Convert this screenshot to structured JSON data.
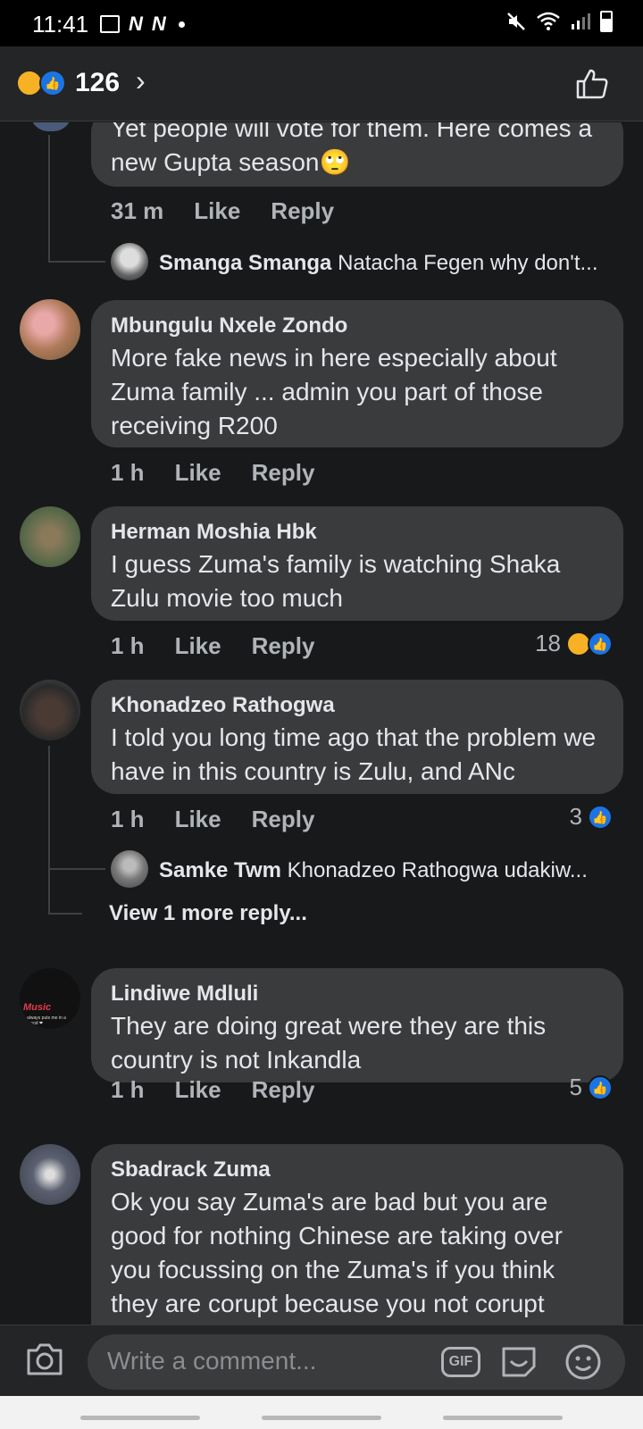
{
  "status_bar": {
    "time": "11:41",
    "n1": "N",
    "n2": "N"
  },
  "header": {
    "reaction_count": "126",
    "chevron": "›"
  },
  "comments_top": {
    "partial_text": "Yet people will vote for them. Here comes a new Gupta season🙄",
    "time": "31 m",
    "like": "Like",
    "reply": "Reply",
    "reply_preview_author": "Smanga Smanga",
    "reply_preview_text": "Natacha Fegen why don't..."
  },
  "comments": [
    {
      "author": "Mbungulu Nxele Zondo",
      "text": "More fake news in here especially about Zuma family ... admin you part of those receiving R200",
      "time": "1 h",
      "like": "Like",
      "reply": "Reply",
      "reactions": ""
    },
    {
      "author": "Herman Moshia Hbk",
      "text": "I guess Zuma's family is watching Shaka Zulu movie too much",
      "time": "1 h",
      "like": "Like",
      "reply": "Reply",
      "reactions": "18"
    },
    {
      "author": "Khonadzeo Rathogwa",
      "text": "I told you long time ago that the problem we have in this country is Zulu, and ANc",
      "time": "1 h",
      "like": "Like",
      "reply": "Reply",
      "reactions": "3",
      "reply_preview_author": "Samke Twm",
      "reply_preview_text": "Khonadzeo Rathogwa udakiw...",
      "view_more": "View 1 more reply..."
    },
    {
      "author": "Lindiwe Mdluli",
      "avatar_text": "Music",
      "avatar_subtext": "always puts me in a mood ❤",
      "text": "They are doing great were they are this country is not Inkandla",
      "time": "1 h",
      "like": "Like",
      "reply": "Reply",
      "reactions": "5"
    },
    {
      "author": "Sbadrack Zuma",
      "text": "Ok you say Zuma's are bad but you are good for nothing Chinese are taking over you focussing on the Zuma's if you think they are corupt  because you not corupt"
    }
  ],
  "composer": {
    "placeholder": "Write a comment...",
    "gif_label": "GIF"
  },
  "icons": {
    "reaction_haha": "haha-emoji-icon",
    "reaction_like": "like-reaction-icon",
    "header_thumb": "thumbs-up-icon",
    "camera": "camera-icon",
    "sticker": "sticker-icon",
    "emoji": "emoji-icon"
  },
  "colors": {
    "background": "#18191a",
    "bubble": "#3a3b3c",
    "like_blue": "#1b74e4",
    "haha_yellow": "#f7b125"
  }
}
